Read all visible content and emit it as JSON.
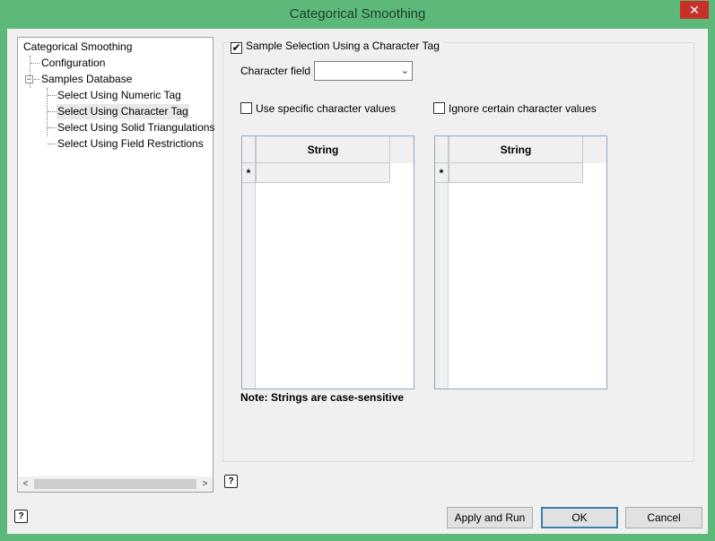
{
  "window": {
    "title": "Categorical Smoothing",
    "close_glyph": "✕"
  },
  "tree": {
    "root": "Categorical Smoothing",
    "items": [
      {
        "label": "Configuration"
      },
      {
        "label": "Samples Database",
        "expander": "−"
      },
      {
        "label": "Select Using Numeric Tag"
      },
      {
        "label": "Select Using Character Tag",
        "selected": true
      },
      {
        "label": "Select Using Solid Triangulations"
      },
      {
        "label": "Select Using Field Restrictions"
      }
    ],
    "scroll_left": "<",
    "scroll_right": ">"
  },
  "sample_selection": {
    "label": "Sample Selection Using a Character Tag",
    "checked": true,
    "check_glyph": "✔"
  },
  "character_field": {
    "label": "Character field",
    "value": "",
    "caret": "⌄"
  },
  "use_specific": {
    "label": "Use specific character values",
    "checked": false
  },
  "ignore_certain": {
    "label": "Ignore certain character values",
    "checked": false
  },
  "grid_left": {
    "header": "String",
    "new_row_marker": "*"
  },
  "grid_right": {
    "header": "String",
    "new_row_marker": "*"
  },
  "note": "Note: Strings are case-sensitive",
  "help_glyph": "?",
  "buttons": {
    "apply_run": "Apply and Run",
    "ok": "OK",
    "cancel": "Cancel"
  }
}
